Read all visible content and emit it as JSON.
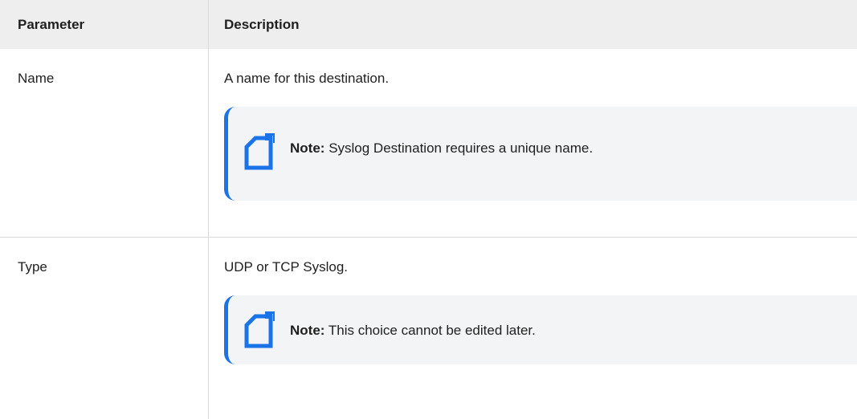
{
  "table": {
    "headers": {
      "parameter": "Parameter",
      "description": "Description"
    },
    "rows": [
      {
        "parameter": "Name",
        "description": "A name for this destination.",
        "note": {
          "icon": "note-icon",
          "label": "Note:",
          "text": "Syslog Destination requires a unique name."
        }
      },
      {
        "parameter": "Type",
        "description": "UDP or TCP Syslog.",
        "note": {
          "icon": "note-icon",
          "label": "Note:",
          "text": "This choice cannot be edited later."
        }
      }
    ]
  },
  "colors": {
    "header_bg": "#eeeeee",
    "note_bg": "#f3f4f6",
    "accent": "#1b73e8"
  }
}
